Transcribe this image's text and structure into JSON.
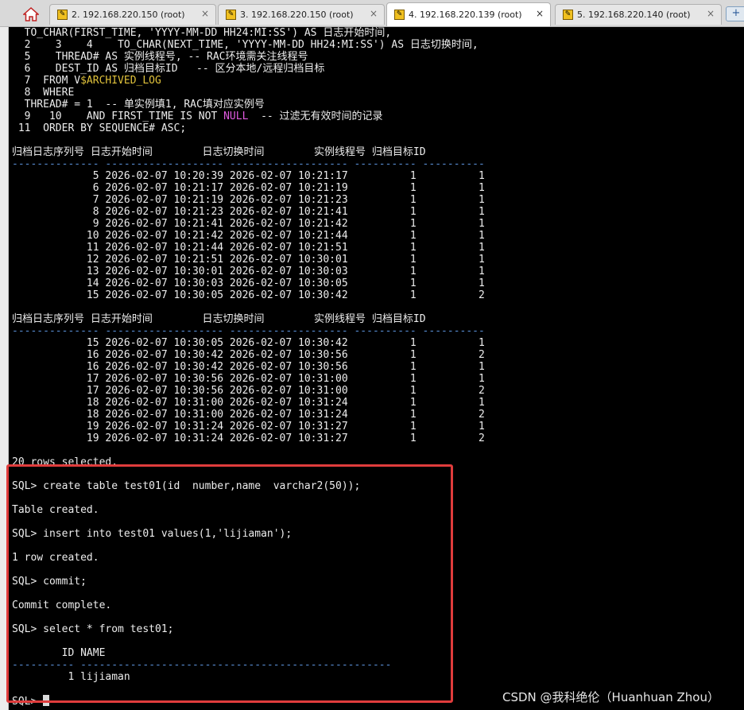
{
  "tabs": [
    {
      "label": "2. 192.168.220.150 (root)",
      "close": "×",
      "active": false
    },
    {
      "label": "3. 192.168.220.150 (root)",
      "close": "×",
      "active": false
    },
    {
      "label": "4. 192.168.220.139 (root)",
      "close": "×",
      "active": true
    },
    {
      "label": "5. 192.168.220.140 (root)",
      "close": "×",
      "active": false
    }
  ],
  "new_tab_label": "+",
  "query_lines": [
    "  TO_CHAR(FIRST_TIME, 'YYYY-MM-DD HH24:MI:SS') AS 日志开始时间,",
    "  2    3    4    TO_CHAR(NEXT_TIME, 'YYYY-MM-DD HH24:MI:SS') AS 日志切换时间,",
    "  5    THREAD# AS 实例线程号, -- RAC环境需关注线程号",
    "  6    DEST_ID AS 归档目标ID   -- 区分本地/远程归档目标",
    "  7  FROM V",
    "  8  WHERE",
    "  THREAD# = 1  -- 单实例填1, RAC填对应实例号",
    "  9   10    AND FIRST_TIME IS NOT ",
    " 11  ORDER BY SEQUENCE# ASC;"
  ],
  "query_tokens": {
    "archived_log": "$ARCHIVED_LOG",
    "null_kw": "NULL",
    "null_comment": "  -- 过滤无有效时间的记录"
  },
  "result_header": "归档日志序列号 日志开始时间        日志切换时间        实例线程号 归档目标ID",
  "result_separator": "-------------- ------------------- ------------------- ---------- ----------",
  "result_block_1": [
    "             5 2026-02-07 10:20:39 2026-02-07 10:21:17          1          1",
    "             6 2026-02-07 10:21:17 2026-02-07 10:21:19          1          1",
    "             7 2026-02-07 10:21:19 2026-02-07 10:21:23          1          1",
    "             8 2026-02-07 10:21:23 2026-02-07 10:21:41          1          1",
    "             9 2026-02-07 10:21:41 2026-02-07 10:21:42          1          1",
    "            10 2026-02-07 10:21:42 2026-02-07 10:21:44          1          1",
    "            11 2026-02-07 10:21:44 2026-02-07 10:21:51          1          1",
    "            12 2026-02-07 10:21:51 2026-02-07 10:30:01          1          1",
    "            13 2026-02-07 10:30:01 2026-02-07 10:30:03          1          1",
    "            14 2026-02-07 10:30:03 2026-02-07 10:30:05          1          1",
    "            15 2026-02-07 10:30:05 2026-02-07 10:30:42          1          2"
  ],
  "result_block_2": [
    "            15 2026-02-07 10:30:05 2026-02-07 10:30:42          1          1",
    "            16 2026-02-07 10:30:42 2026-02-07 10:30:56          1          2",
    "            16 2026-02-07 10:30:42 2026-02-07 10:30:56          1          1",
    "            17 2026-02-07 10:30:56 2026-02-07 10:31:00          1          1",
    "            17 2026-02-07 10:30:56 2026-02-07 10:31:00          1          2",
    "            18 2026-02-07 10:31:00 2026-02-07 10:31:24          1          1",
    "            18 2026-02-07 10:31:00 2026-02-07 10:31:24          1          2",
    "            19 2026-02-07 10:31:24 2026-02-07 10:31:27          1          1",
    "            19 2026-02-07 10:31:24 2026-02-07 10:31:27          1          2"
  ],
  "rows_selected": "20 rows selected.",
  "session_lines": [
    "SQL> create table test01(id  number,name  varchar2(50));",
    "Table created.",
    "SQL> insert into test01 values(1,'lijiaman');",
    "1 row created.",
    "SQL> commit;",
    "Commit complete.",
    "SQL> select * from test01;",
    "        ID NAME",
    "",
    "         1 lijiaman",
    "SQL> "
  ],
  "select_dash_a": "----------",
  "select_dash_b": "--------------------------------------------------",
  "watermark": "CSDN @我科绝伦（Huanhuan Zhou）",
  "colors": {
    "highlight_box": "#e03c3c",
    "dash_line": "#5a8fd6",
    "null_keyword": "#e05adf",
    "view_name": "#e0c23b",
    "terminal_bg": "#000000",
    "terminal_text": "#ededed"
  },
  "icons": {
    "home": "home-icon",
    "tab": "key-icon",
    "close": "close-icon",
    "new_tab": "new-tab-icon"
  }
}
